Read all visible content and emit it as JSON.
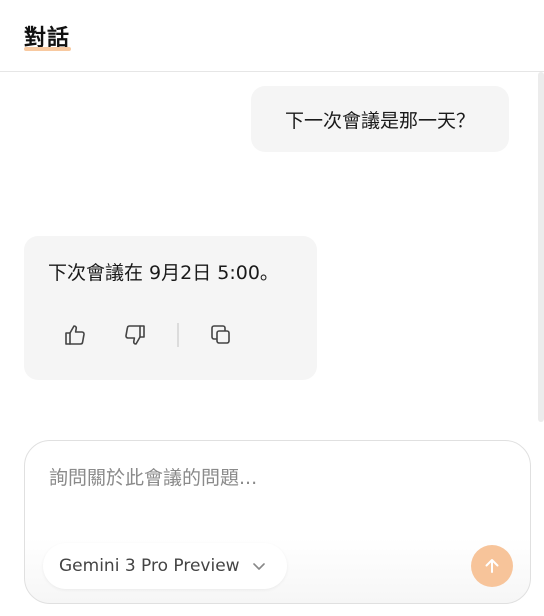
{
  "header": {
    "title": "對話"
  },
  "messages": {
    "user": "下一次會議是那一天？",
    "assistant": "下次會議在 9月2日 5:00。"
  },
  "actions": {
    "icons": [
      "thumbs-up-icon",
      "thumbs-down-icon",
      "copy-icon"
    ]
  },
  "composer": {
    "placeholder": "詢問關於此會議的問題...",
    "model": "Gemini 3 Pro Preview",
    "send_icon": "arrow-up-icon"
  },
  "colors": {
    "accent": "#f7c49a",
    "bubble": "#f5f5f5"
  }
}
